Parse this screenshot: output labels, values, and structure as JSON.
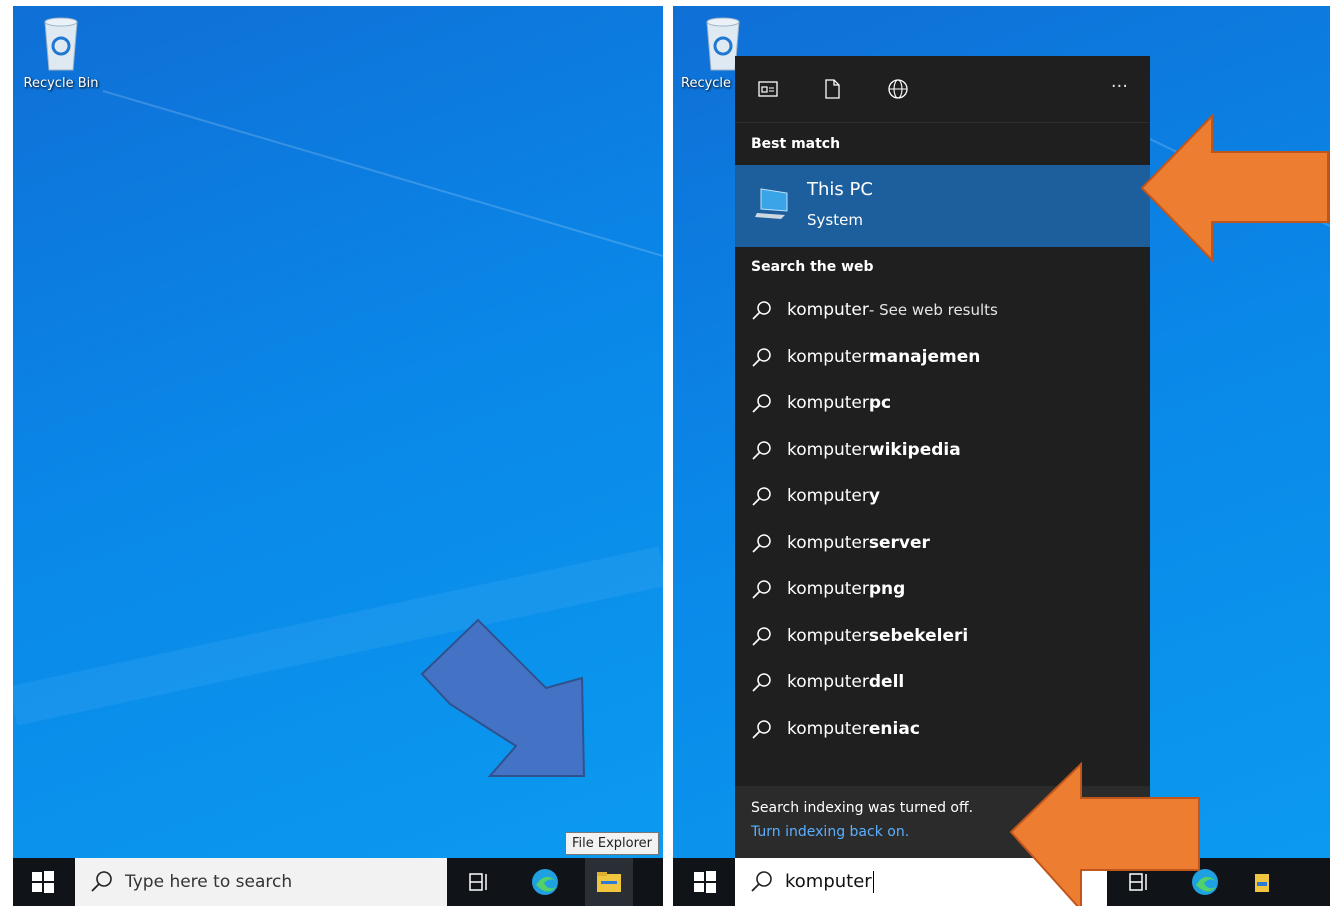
{
  "left": {
    "desktop_icon_label": "Recycle Bin",
    "search_placeholder": "Type here to search",
    "tooltip": "File Explorer"
  },
  "right": {
    "desktop_icon_label": "Recycle",
    "best_match_heading": "Best match",
    "best_match": {
      "title": "This PC",
      "subtitle": "System"
    },
    "web_heading": "Search the web",
    "web_results": [
      {
        "prefix": "komputer",
        "bold": "",
        "suffix": " - See web results"
      },
      {
        "prefix": "komputer ",
        "bold": "manajemen",
        "suffix": ""
      },
      {
        "prefix": "komputer ",
        "bold": "pc",
        "suffix": ""
      },
      {
        "prefix": "komputer ",
        "bold": "wikipedia",
        "suffix": ""
      },
      {
        "prefix": "komputer",
        "bold": "y",
        "suffix": ""
      },
      {
        "prefix": "komputer ",
        "bold": "server",
        "suffix": ""
      },
      {
        "prefix": "komputer ",
        "bold": "png",
        "suffix": ""
      },
      {
        "prefix": "komputer ",
        "bold": "sebekeleri",
        "suffix": ""
      },
      {
        "prefix": "komputer ",
        "bold": "dell",
        "suffix": ""
      },
      {
        "prefix": "komputer ",
        "bold": "eniac",
        "suffix": ""
      }
    ],
    "footer_text": "Search indexing was turned off.",
    "footer_link": "Turn indexing back on.",
    "more_label": "···",
    "query": "komputer"
  },
  "colors": {
    "arrow_blue": "#4472c4",
    "arrow_orange": "#ed7d31",
    "selection": "#1c5f9c",
    "link": "#5ab0ff"
  }
}
